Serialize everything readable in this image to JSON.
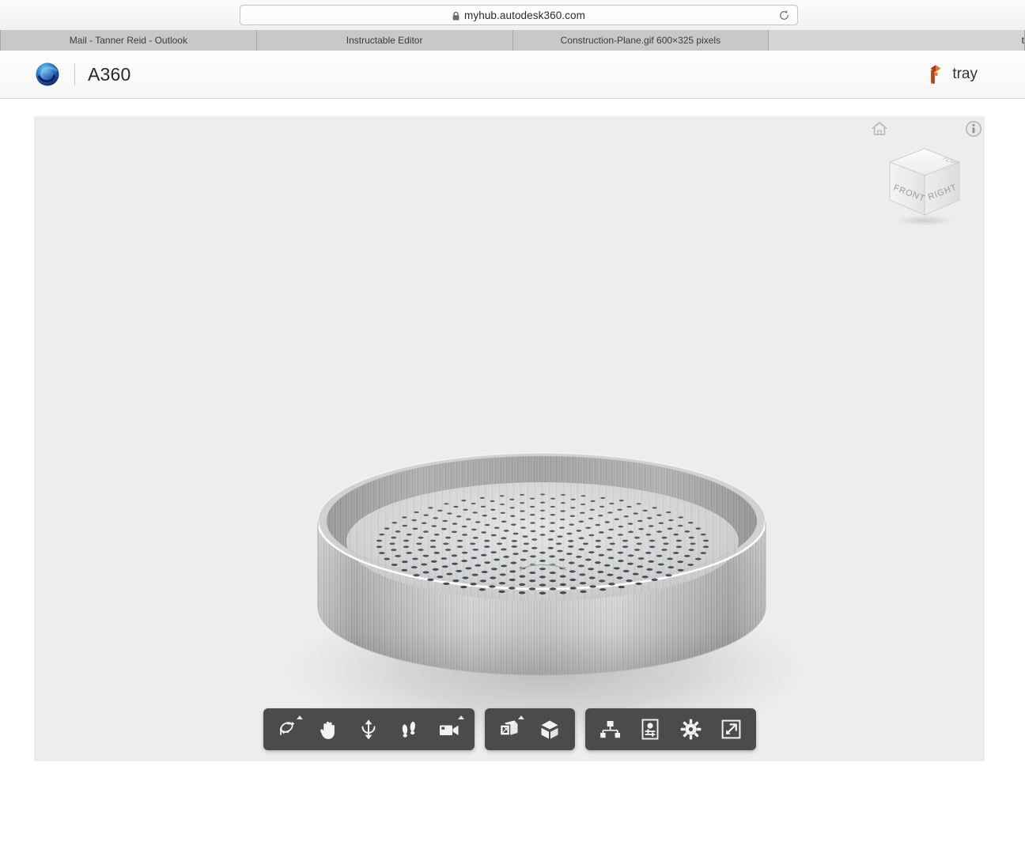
{
  "browser": {
    "url": "myhub.autodesk360.com",
    "lock_icon": "lock-icon",
    "reload_icon": "reload-icon",
    "tabs": [
      {
        "label": "Mail - Tanner Reid - Outlook",
        "active": false
      },
      {
        "label": "Instructable Editor",
        "active": false
      },
      {
        "label": "Construction-Plane.gif 600×325 pixels",
        "active": false
      },
      {
        "label": "t",
        "active": true
      }
    ]
  },
  "app_header": {
    "logo_icon": "a360-logo-icon",
    "brand_name": "A360",
    "document_icon": "fusion360-icon",
    "document_title": "tray"
  },
  "viewer": {
    "home_icon": "home-icon",
    "info_icon": "info-icon",
    "viewcube": {
      "name": "view-cube",
      "faces": {
        "top": "TOP",
        "front": "FRONT",
        "right": "RIGHT"
      }
    },
    "model": {
      "name": "perforated-tray-model",
      "description": "Brushed aluminum cylindrical tray with perforated base"
    },
    "background_color": "#ededed"
  },
  "toolbar": {
    "groups": [
      {
        "name": "navigation-group",
        "buttons": [
          {
            "name": "orbit-tool",
            "icon": "orbit-icon",
            "label": "Orbit",
            "has_dropdown": true
          },
          {
            "name": "pan-tool",
            "icon": "hand-icon",
            "label": "Pan",
            "has_dropdown": false
          },
          {
            "name": "zoom-tool",
            "icon": "zoom-icon",
            "label": "Zoom",
            "has_dropdown": false
          },
          {
            "name": "walk-tool",
            "icon": "footprints-icon",
            "label": "Walk",
            "has_dropdown": false
          },
          {
            "name": "camera-tool",
            "icon": "camera-icon",
            "label": "Camera",
            "has_dropdown": true
          }
        ]
      },
      {
        "name": "section-group",
        "buttons": [
          {
            "name": "section-analysis-tool",
            "icon": "section-box-icon",
            "label": "Section Analysis",
            "has_dropdown": true
          },
          {
            "name": "explode-tool",
            "icon": "explode-cube-icon",
            "label": "Explode",
            "has_dropdown": false
          }
        ]
      },
      {
        "name": "panels-group",
        "buttons": [
          {
            "name": "model-browser-tool",
            "icon": "model-tree-icon",
            "label": "Model Browser",
            "has_dropdown": false
          },
          {
            "name": "properties-tool",
            "icon": "properties-icon",
            "label": "Properties",
            "has_dropdown": false
          },
          {
            "name": "settings-tool",
            "icon": "gear-icon",
            "label": "Settings",
            "has_dropdown": false
          },
          {
            "name": "fullscreen-tool",
            "icon": "fullscreen-icon",
            "label": "Full Screen",
            "has_dropdown": false
          }
        ]
      }
    ]
  },
  "colors": {
    "toolbar_bg": "#4b4b4b",
    "viewport_bg": "#ededed",
    "tab_bar_bg": "#b8b8b8",
    "tab_bg": "#c8c8c8",
    "tab_active_bg": "#d4d4d4",
    "brand_blue": "#1c4fa1",
    "fusion_orange": "#d4521f"
  }
}
